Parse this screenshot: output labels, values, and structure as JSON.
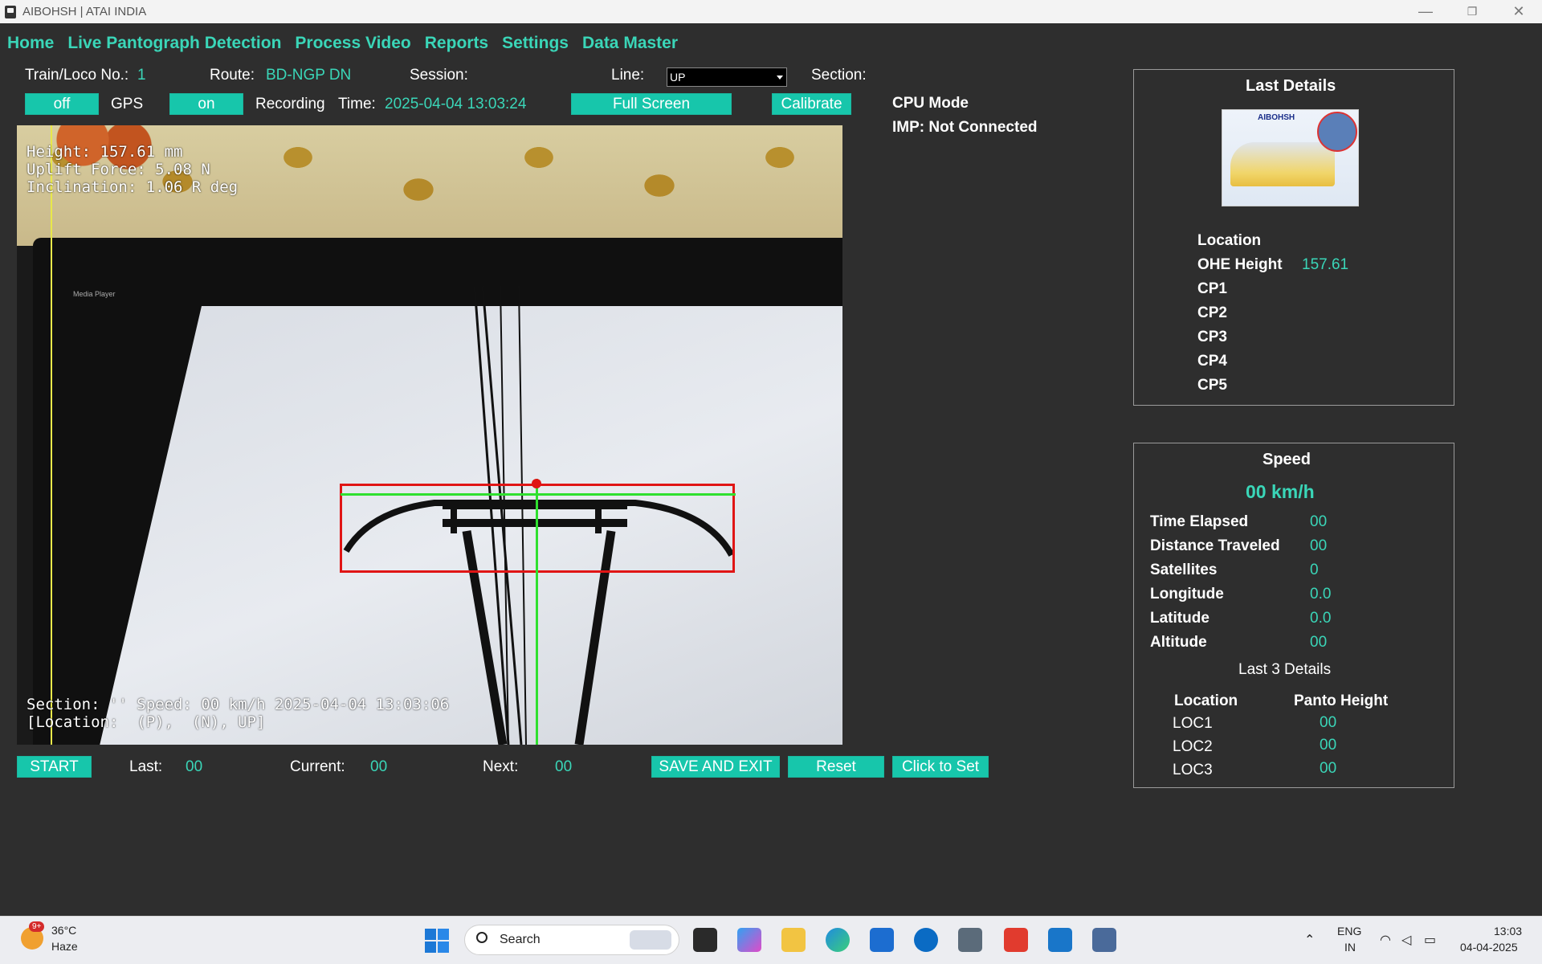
{
  "window": {
    "title": "AIBOHSH | ATAI INDIA",
    "minimize": "—",
    "restore": "❐",
    "close": "✕"
  },
  "menu": [
    "Home",
    "Live Pantograph Detection",
    "Process Video",
    "Reports",
    "Settings",
    "Data Master"
  ],
  "info": {
    "train_label": "Train/Loco No.:",
    "train_value": "1",
    "route_label": "Route:",
    "route_value": "BD-NGP DN",
    "session_label": "Session:",
    "line_label": "Line:",
    "line_value": "UP",
    "section_label": "Section:"
  },
  "controls": {
    "gps_toggle": "off",
    "gps_label": "GPS",
    "recording_toggle": "on",
    "recording_label": "Recording",
    "time_label": "Time:",
    "time_value": "2025-04-04 13:03:24",
    "fullscreen": "Full Screen",
    "calibrate": "Calibrate"
  },
  "status": {
    "cpu_mode": "CPU Mode",
    "imp": "IMP: Not Connected"
  },
  "video_osd": {
    "height": "Height: 157.61 mm",
    "uplift": "Uplift Force: 5.08 N",
    "inclination": "Inclination: 1.06 R deg",
    "bottom1": "Section: '' Speed: 00 km/h 2025-04-04 13:03:06",
    "bottom2": "[Location:  (P),  (N), UP]",
    "media_player": "Media Player"
  },
  "bottom_bar": {
    "start": "START",
    "last_label": "Last:",
    "last_value": "00",
    "current_label": "Current:",
    "current_value": "00",
    "next_label": "Next:",
    "next_value": "00",
    "save_exit": "SAVE AND EXIT",
    "reset": "Reset",
    "click_to_set": "Click to Set"
  },
  "last_details": {
    "title": "Last Details",
    "logo_text": "AIBOHSH",
    "location_label": "Location",
    "ohe_label": "OHE Height",
    "ohe_value": "157.61",
    "cp": [
      "CP1",
      "CP2",
      "CP3",
      "CP4",
      "CP5"
    ]
  },
  "speed_panel": {
    "title": "Speed",
    "speed_value": "00 km/h",
    "rows": [
      {
        "label": "Time Elapsed",
        "value": "00"
      },
      {
        "label": "Distance Traveled",
        "value": "00"
      },
      {
        "label": "Satellites",
        "value": "0"
      },
      {
        "label": "Longitude",
        "value": "0.0"
      },
      {
        "label": "Latitude",
        "value": "0.0"
      },
      {
        "label": "Altitude",
        "value": "00"
      }
    ],
    "last3_title": "Last 3 Details",
    "col_location": "Location",
    "col_panto": "Panto Height",
    "locs": [
      {
        "loc": "LOC1",
        "val": "00"
      },
      {
        "loc": "LOC2",
        "val": "00"
      },
      {
        "loc": "LOC3",
        "val": "00"
      }
    ]
  },
  "taskbar": {
    "weather_temp": "36°C",
    "weather_desc": "Haze",
    "weather_badge": "9+",
    "search": "Search",
    "lang1": "ENG",
    "lang2": "IN",
    "clock_time": "13:03",
    "clock_date": "04-04-2025"
  },
  "colors": {
    "accent": "#3ad6b8",
    "button": "#17c6ab",
    "background": "#2e2e2e"
  }
}
